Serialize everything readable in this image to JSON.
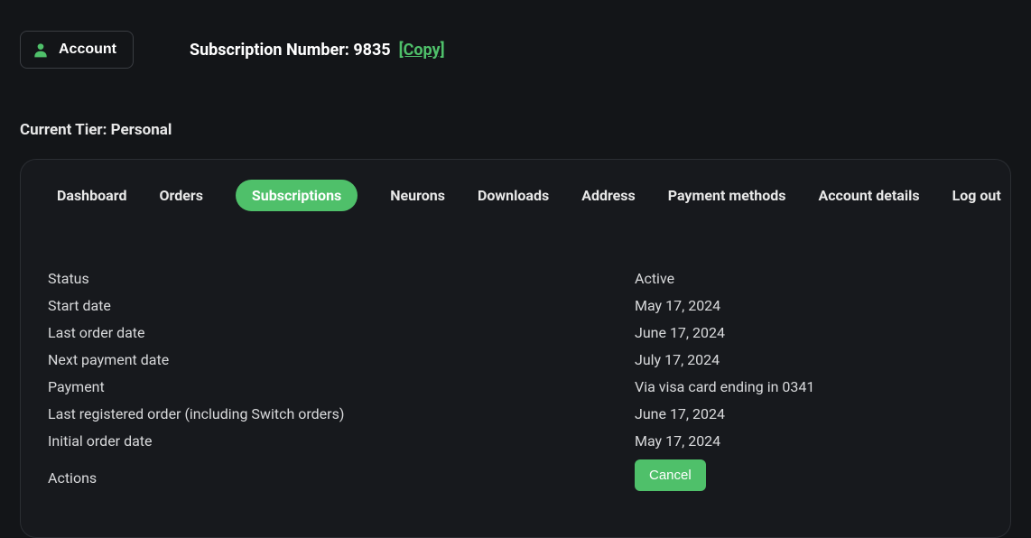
{
  "header": {
    "account_label": "Account",
    "subscription_label": "Subscription Number: ",
    "subscription_number": "9835",
    "copy_label": "[Copy]"
  },
  "tier": {
    "label": "Current Tier: ",
    "value": "Personal"
  },
  "tabs": {
    "dashboard": "Dashboard",
    "orders": "Orders",
    "subscriptions": "Subscriptions",
    "neurons": "Neurons",
    "downloads": "Downloads",
    "address": "Address",
    "payment_methods": "Payment methods",
    "account_details": "Account details",
    "log_out": "Log out"
  },
  "details": {
    "status_label": "Status",
    "status_value": "Active",
    "start_date_label": "Start date",
    "start_date_value": "May 17, 2024",
    "last_order_label": "Last order date",
    "last_order_value": "June 17, 2024",
    "next_payment_label": "Next payment date",
    "next_payment_value": "July 17, 2024",
    "payment_label": "Payment",
    "payment_value": "Via visa card ending in 0341",
    "last_registered_label": "Last registered order (including Switch orders)",
    "last_registered_value": "June 17, 2024",
    "initial_order_label": "Initial order date",
    "initial_order_value": "May 17, 2024",
    "actions_label": "Actions",
    "cancel_label": "Cancel"
  },
  "colors": {
    "accent": "#4fc06a",
    "bg": "#131518",
    "panel": "#17191d"
  }
}
